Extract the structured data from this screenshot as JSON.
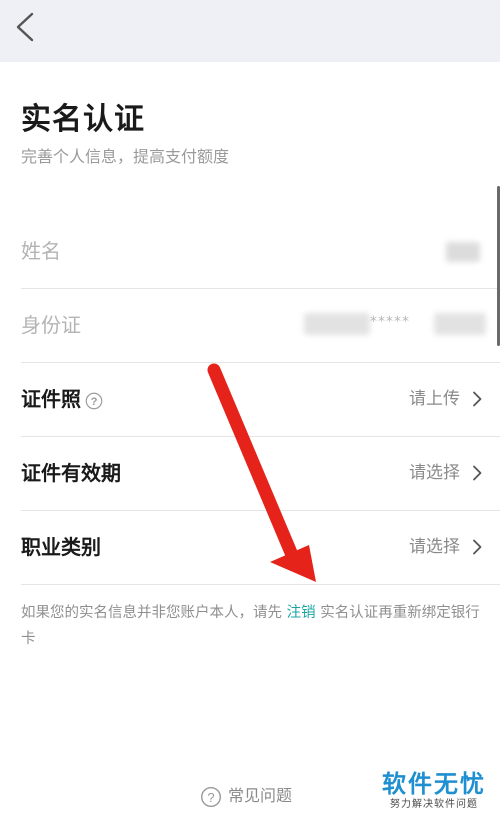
{
  "header": {
    "back_icon": "chevron-left-icon"
  },
  "page": {
    "title": "实名认证",
    "subtitle": "完善个人信息，提高支付额度"
  },
  "form": {
    "rows": [
      {
        "label": "姓名",
        "value": ""
      },
      {
        "label": "身份证",
        "value": "*****"
      },
      {
        "label": "证件照",
        "value": "请上传",
        "help_icon": "question-circle-icon"
      },
      {
        "label": "证件有效期",
        "value": "请选择"
      },
      {
        "label": "职业类别",
        "value": "请选择"
      }
    ]
  },
  "notice": {
    "before": "如果您的实名信息并非您账户本人，请先 ",
    "link": "注销",
    "after": " 实名认证再重新绑定银行卡"
  },
  "footer": {
    "faq_label": "常见问题",
    "faq_icon": "question-circle-icon"
  },
  "watermark": {
    "title": "软件无忧",
    "subtitle": "努力解决软件问题"
  },
  "annotation": {
    "color": "#e5231b"
  }
}
